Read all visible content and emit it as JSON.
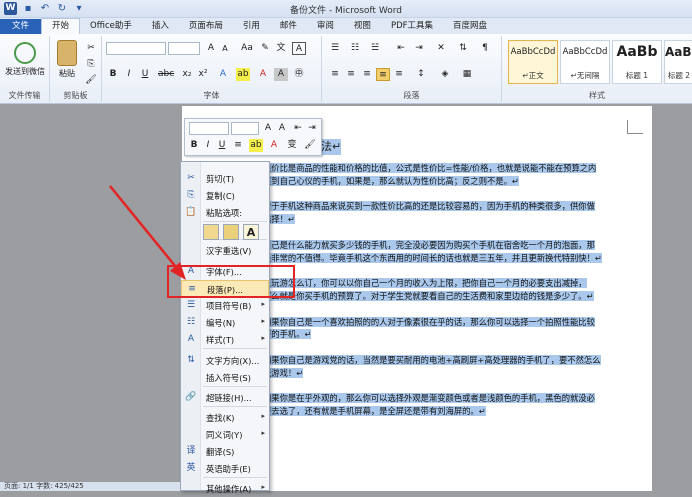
{
  "window": {
    "title": "备份文件 - Microsoft Word"
  },
  "tabs": [
    "文件",
    "开始",
    "Office助手",
    "插入",
    "页面布局",
    "引用",
    "邮件",
    "审阅",
    "视图",
    "PDF工具集",
    "百度网盘"
  ],
  "ribbon": {
    "send_wechat": "发送到微信",
    "paste": "粘贴",
    "groups": {
      "file_transfer": "文件传输",
      "clipboard": "剪贴板",
      "font": "字体",
      "paragraph": "段落",
      "styles": "样式"
    },
    "styles": [
      {
        "sample": "AaBbCcDd",
        "name": "↵正文"
      },
      {
        "sample": "AaBbCcDd",
        "name": "↵无间隔"
      },
      {
        "sample": "AaBb",
        "name": "标题 1"
      },
      {
        "sample": "AaBl",
        "name": "标题 2"
      }
    ]
  },
  "doc": {
    "title": "方法↵",
    "lines": [
      "性价比是商品的性能和价格的比值，公式是性价比=性能/价格，也就是说能不能在预算之内",
      "买到自己心仪的手机，如果是，那么就认为性价比高；反之则不是。↵",
      "",
      "对于手机这种商品来说买到一款性价比高的还是比较容易的，因为手机的种类很多，供你做",
      "选择！↵",
      "",
      "自己是什么能力就买多少钱的手机，完全没必要因为购买个手机在宿舍吃一个月的泡面，那",
      "是非常的不值得。毕竟手机这个东西用的时间长的话也就是三五年，并且更新换代特别快！↵",
      "",
      "王玩游怎么订，你可以以你自己一个月的收入为上限，把你自己一个月的必要支出减掉，",
      "那么就是你买手机的预算了。对于学生党就要看自己的生活费和家里边给的钱是多少了。↵",
      "",
      "如果你自己是一个喜欢拍照的的人对于像素很在乎的话，那么你可以选择一个拍照性能比较",
      "好的手机。↵",
      "",
      "如果你自己是游戏党的话，当然是要买耐用的电池+高刷屏+高处理器的手机了，要不然怎么",
      "玩游戏！↵",
      "",
      "如果你是在乎外观的，那么你可以选择外观是渐变颜色或者是浅颜色的手机，黑色的就没必",
      "要去选了，还有就是手机屏幕，是全屏还是带有刘海屏的。↵"
    ]
  },
  "menu": {
    "items": [
      {
        "icon": "cut-icon",
        "glyph": "✂",
        "label": "剪切(T)"
      },
      {
        "icon": "copy-icon",
        "glyph": "⎘",
        "label": "复制(C)"
      },
      {
        "icon": "paste-icon",
        "glyph": "📋",
        "label": "粘贴选项:"
      },
      {
        "icon": "",
        "glyph": "",
        "label": "汉字重选(V)"
      },
      {
        "icon": "font-icon",
        "glyph": "A",
        "label": "字体(F)..."
      },
      {
        "icon": "paragraph-icon",
        "glyph": "≡",
        "label": "段落(P)..."
      },
      {
        "icon": "bullets-icon",
        "glyph": "☰",
        "label": "项目符号(B)"
      },
      {
        "icon": "numbering-icon",
        "glyph": "☷",
        "label": "编号(N)"
      },
      {
        "icon": "styles-icon",
        "glyph": "A",
        "label": "样式(T)"
      },
      {
        "icon": "text-direction-icon",
        "glyph": "⇅",
        "label": "文字方向(X)..."
      },
      {
        "icon": "",
        "glyph": "",
        "label": "插入符号(S)"
      },
      {
        "icon": "hyperlink-icon",
        "glyph": "🔗",
        "label": "超链接(H)..."
      },
      {
        "icon": "",
        "glyph": "",
        "label": "查找(K)"
      },
      {
        "icon": "",
        "glyph": "",
        "label": "同义词(Y)"
      },
      {
        "icon": "translate-icon",
        "glyph": "译",
        "label": "翻译(S)"
      },
      {
        "icon": "english-assistant-icon",
        "glyph": "英",
        "label": "英语助手(E)"
      },
      {
        "icon": "",
        "glyph": "",
        "label": "其他操作(A)"
      }
    ]
  },
  "status": {
    "text": "页面: 1/1   字数: 425/425"
  }
}
